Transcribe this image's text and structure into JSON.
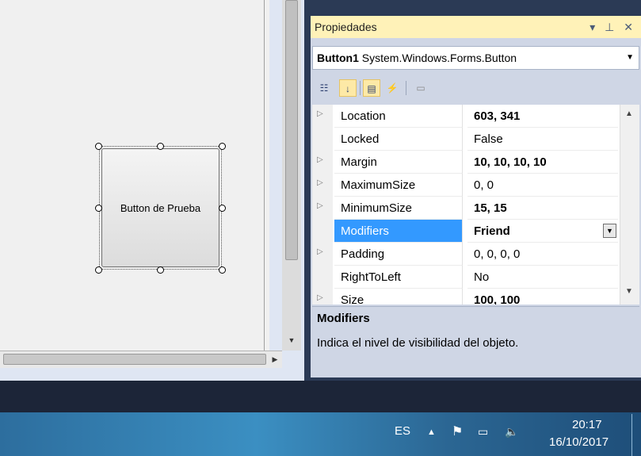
{
  "designer": {
    "button_text": "Button de Prueba"
  },
  "properties": {
    "title": "Propiedades",
    "title_buttons": "▾ ⊥ ✕",
    "object_name": "Button1",
    "object_type": "System.Windows.Forms.Button",
    "rows": [
      {
        "name": "Location",
        "value": "603, 341",
        "bold": true,
        "expandable": true
      },
      {
        "name": "Locked",
        "value": "False",
        "bold": false,
        "expandable": false
      },
      {
        "name": "Margin",
        "value": "10, 10, 10, 10",
        "bold": true,
        "expandable": true
      },
      {
        "name": "MaximumSize",
        "value": "0, 0",
        "bold": false,
        "expandable": true
      },
      {
        "name": "MinimumSize",
        "value": "15, 15",
        "bold": true,
        "expandable": true
      },
      {
        "name": "Modifiers",
        "value": "Friend",
        "bold": true,
        "expandable": false,
        "selected": true
      },
      {
        "name": "Padding",
        "value": "0, 0, 0, 0",
        "bold": false,
        "expandable": true
      },
      {
        "name": "RightToLeft",
        "value": "No",
        "bold": false,
        "expandable": false
      },
      {
        "name": "Size",
        "value": "100, 100",
        "bold": true,
        "expandable": true
      }
    ],
    "description_title": "Modifiers",
    "description_text": "Indica el nivel de visibilidad del objeto."
  },
  "taskbar": {
    "language": "ES",
    "time": "20:17",
    "date": "16/10/2017"
  },
  "colors": {
    "selection": "#3399ff",
    "title_bar": "#fff2b8",
    "panel_bg": "#cfd6e5"
  }
}
